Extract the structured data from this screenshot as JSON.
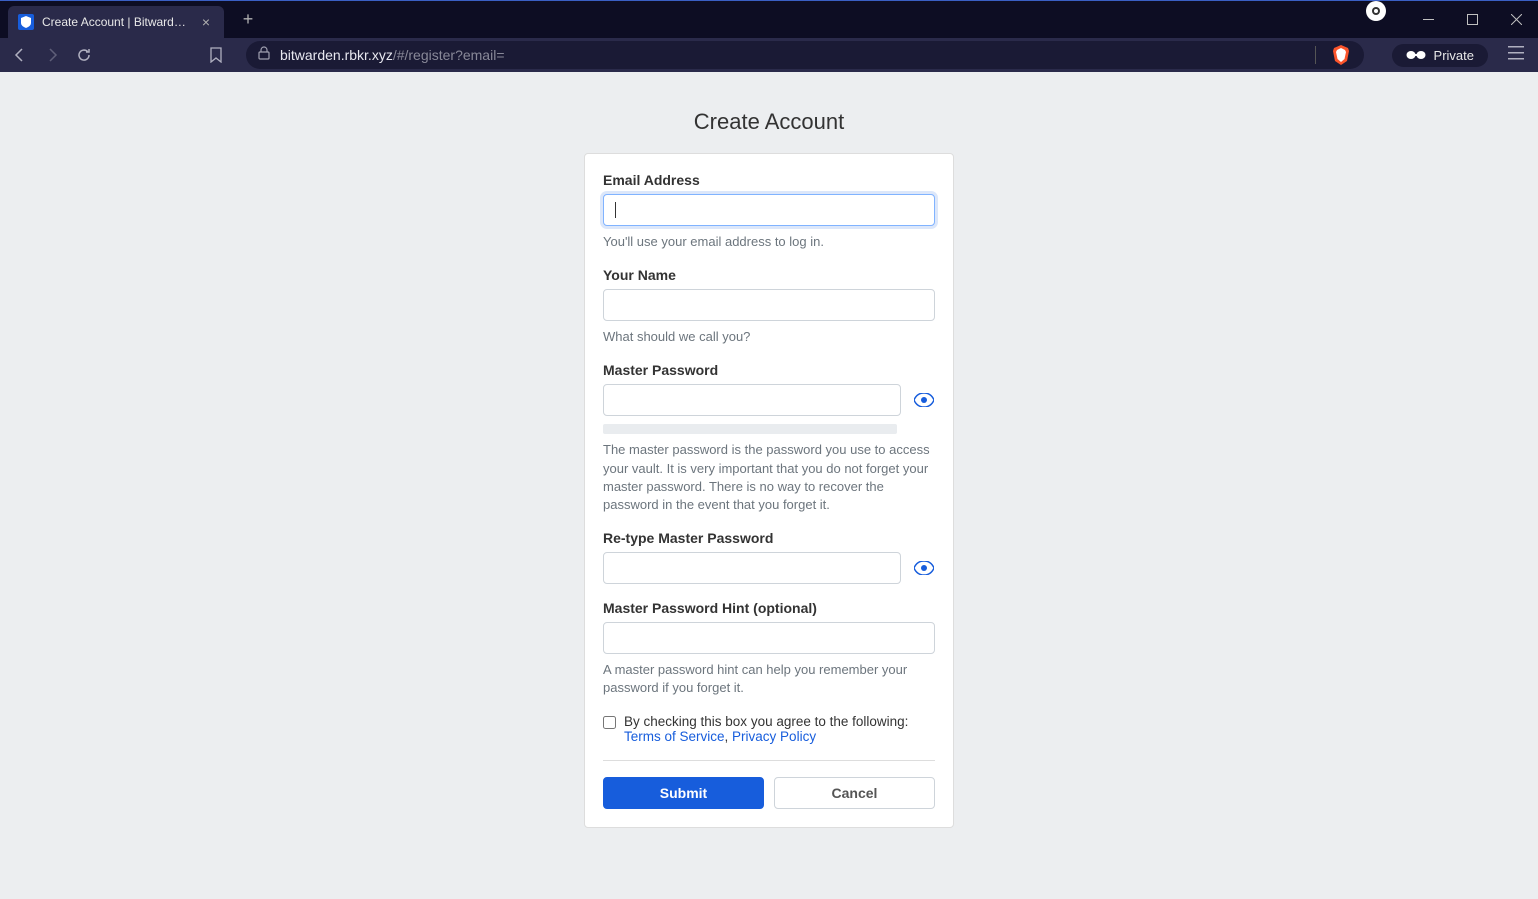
{
  "browser": {
    "tab_title": "Create Account | Bitwarden Web",
    "url_host": "bitwarden.rbkr.xyz",
    "url_path": "/#/register?email=",
    "private_label": "Private"
  },
  "page": {
    "title": "Create Account",
    "email": {
      "label": "Email Address",
      "value": "",
      "help": "You'll use your email address to log in."
    },
    "name": {
      "label": "Your Name",
      "value": "",
      "help": "What should we call you?"
    },
    "master_password": {
      "label": "Master Password",
      "value": "",
      "help": "The master password is the password you use to access your vault. It is very important that you do not forget your master password. There is no way to recover the password in the event that you forget it."
    },
    "retype_password": {
      "label": "Re-type Master Password",
      "value": ""
    },
    "hint": {
      "label": "Master Password Hint (optional)",
      "value": "",
      "help": "A master password hint can help you remember your password if you forget it."
    },
    "agree": {
      "text": "By checking this box you agree to the following:",
      "tos": "Terms of Service",
      "comma": ", ",
      "privacy": "Privacy Policy"
    },
    "buttons": {
      "submit": "Submit",
      "cancel": "Cancel"
    }
  }
}
